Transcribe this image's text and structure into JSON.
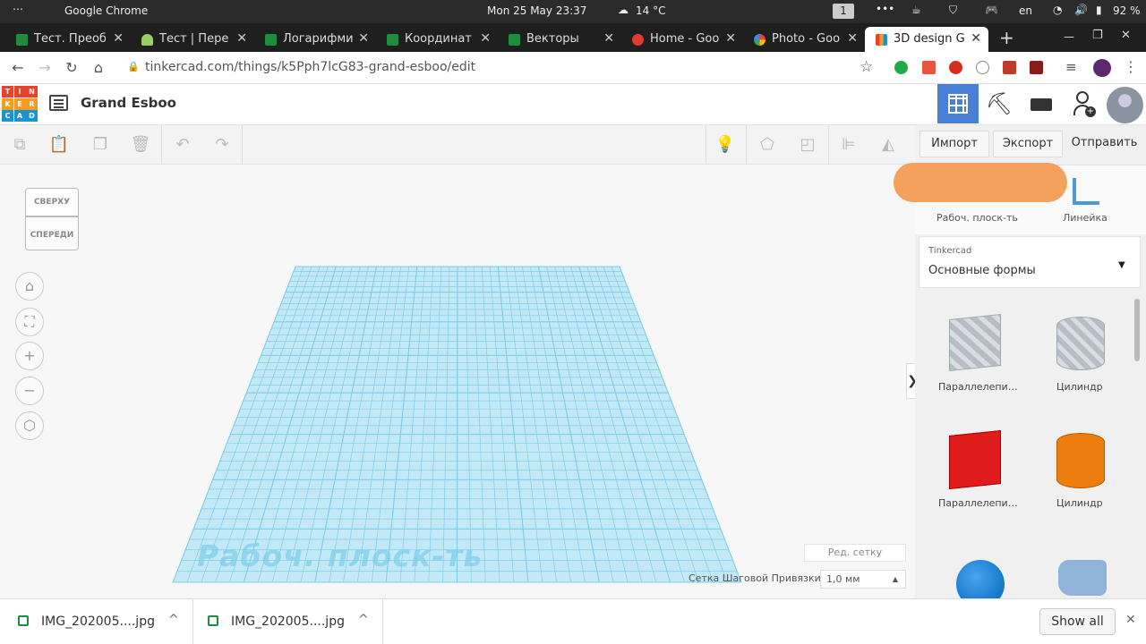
{
  "system": {
    "menu": "⋯",
    "app": "Google Chrome",
    "datetime": "Mon 25 May  23:37",
    "weather": "14 °C",
    "workspace": "1",
    "lang": "en",
    "battery": "92 %"
  },
  "tabs": [
    {
      "title": "Тест. Преоб",
      "color": "#1e8e3e"
    },
    {
      "title": "Тест | Пере",
      "color": "#9ccc65"
    },
    {
      "title": "Логарифми",
      "color": "#1e8e3e"
    },
    {
      "title": "Координат",
      "color": "#1e8e3e"
    },
    {
      "title": "Векторы",
      "color": "#1e8e3e"
    },
    {
      "title": "Home - Goo",
      "color": "#e53935"
    },
    {
      "title": "Photo - Goo",
      "color": "#fbbc04"
    },
    {
      "title": "3D design G",
      "color": "#4285f4",
      "active": true
    }
  ],
  "tab_close": "✕",
  "new_tab": "+",
  "window": {
    "minimize": "—",
    "restore": "❐",
    "close": "✕"
  },
  "address": {
    "url": "tinkercad.com/things/k5Pph7lcG83-grand-esboo/edit"
  },
  "logo_letters": [
    "T",
    "I",
    "N",
    "K",
    "E",
    "R",
    "C",
    "A",
    "D"
  ],
  "logo_colors": [
    "#e8412c",
    "#e8412c",
    "#e8412c",
    "#f49b24",
    "#f49b24",
    "#f49b24",
    "#1b93d3",
    "#1b93d3",
    "#1b93d3"
  ],
  "project": {
    "title": "Grand Esboo"
  },
  "panel": {
    "import": "Импорт",
    "export": "Экспорт",
    "send": "Отправить",
    "workplane": "Рабоч. плоск-ть",
    "ruler": "Линейка",
    "library_label": "Tinkercad",
    "library_value": "Основные формы",
    "shapes": [
      {
        "label": "Параллелепи…",
        "color": "#b8bcc4"
      },
      {
        "label": "Цилиндр",
        "color": "#b8bcc4"
      },
      {
        "label": "Параллелепи…",
        "color": "#e01b1b"
      },
      {
        "label": "Цилиндр",
        "color": "#ee7d0f"
      },
      {
        "label": "",
        "color": "#1a7ed1"
      },
      {
        "label": "",
        "color": "#8fb3d9"
      }
    ]
  },
  "viewcube": {
    "top": "СВЕРХУ",
    "front": "СПЕРЕДИ"
  },
  "workspace": {
    "plane_label": "Рабоч. плоск-ть",
    "edit_grid": "Ред. сетку",
    "snap_label": "Сетка Шаговой Привязки",
    "snap_value": "1,0 мм",
    "collapse": "❯"
  },
  "downloads": [
    {
      "name": "IMG_202005....jpg"
    },
    {
      "name": "IMG_202005....jpg"
    }
  ],
  "show_all": "Show all",
  "colors": {
    "grid": "#7ecde9",
    "grid_fill": "#c3e9f7",
    "accent": "#4a7fd6",
    "redaction": "#f4a15d"
  }
}
